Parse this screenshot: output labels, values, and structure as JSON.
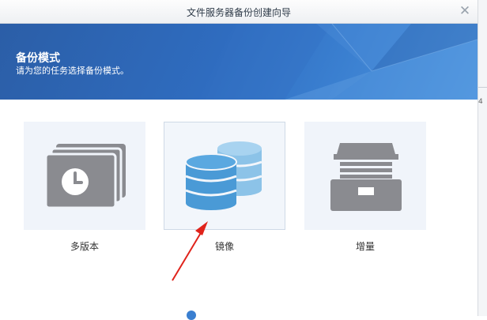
{
  "dialog": {
    "title": "文件服务器备份创建向导",
    "close_glyph": "✕"
  },
  "banner": {
    "title": "备份模式",
    "subtitle": "请为您的任务选择备份模式。"
  },
  "modes": [
    {
      "label": "多版本",
      "icon": "multi-version-clock-stack-icon",
      "selected": false
    },
    {
      "label": "镜像",
      "icon": "database-stack-icon",
      "selected": true
    },
    {
      "label": "增量",
      "icon": "archive-drawer-icon",
      "selected": false
    }
  ],
  "colors": {
    "banner_blue": "#2f6cbf",
    "icon_gray": "#8a8b90",
    "icon_blue": "#4a9ad6",
    "icon_blue_light": "#8cc3e8",
    "arrow_red": "#e0231b",
    "link_blue": "#3a7fd0"
  },
  "edge": {
    "char": "4"
  }
}
